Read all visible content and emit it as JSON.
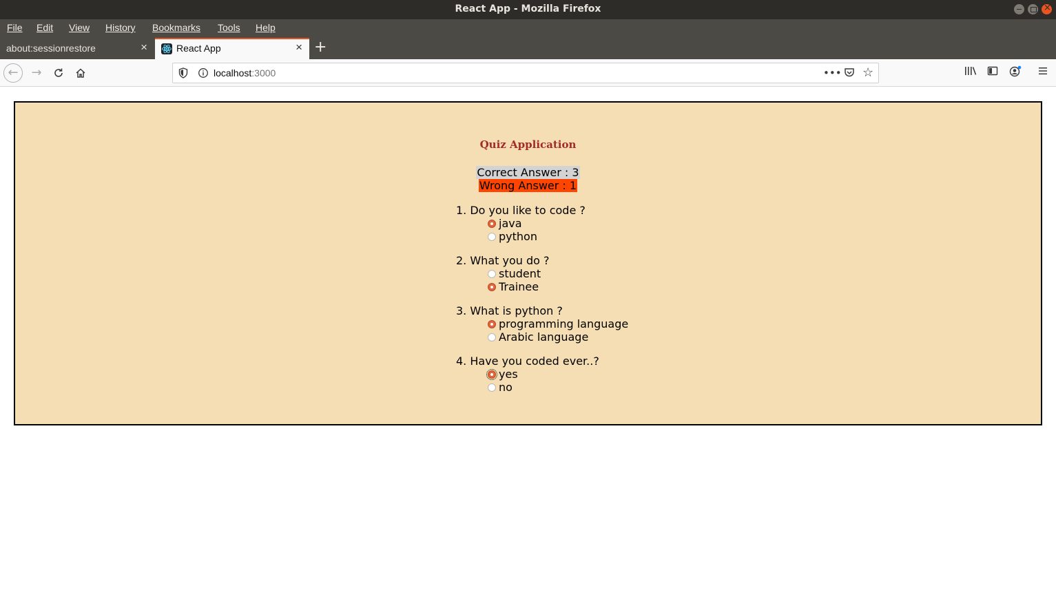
{
  "window": {
    "title": "React App - Mozilla Firefox"
  },
  "menu": {
    "items": [
      {
        "label": "File"
      },
      {
        "label": "Edit"
      },
      {
        "label": "View"
      },
      {
        "label": "History"
      },
      {
        "label": "Bookmarks"
      },
      {
        "label": "Tools"
      },
      {
        "label": "Help"
      }
    ]
  },
  "tabs": [
    {
      "label": "about:sessionrestore",
      "active": false
    },
    {
      "label": "React App",
      "active": true
    }
  ],
  "navbar": {
    "url_host": "localhost",
    "url_port": ":3000"
  },
  "quiz": {
    "title": "Quiz Application",
    "correct_label": "Correct Answer : 3",
    "wrong_label": "Wrong Answer : 1",
    "questions": [
      {
        "text": "1. Do you like to code ?",
        "options": [
          {
            "label": "java",
            "checked": true
          },
          {
            "label": "python",
            "checked": false
          }
        ]
      },
      {
        "text": "2. What you do ?",
        "options": [
          {
            "label": "student",
            "checked": false
          },
          {
            "label": "Trainee",
            "checked": true
          }
        ]
      },
      {
        "text": "3. What is python ?",
        "options": [
          {
            "label": "programming language",
            "checked": true
          },
          {
            "label": "Arabic language",
            "checked": false
          }
        ]
      },
      {
        "text": "4. Have you coded ever..?",
        "options": [
          {
            "label": "yes",
            "checked": true
          },
          {
            "label": "no",
            "checked": false
          }
        ]
      }
    ]
  },
  "colors": {
    "quiz_background": "#f5deb3",
    "title_color": "#a52a2a",
    "correct_highlight": "#d3d3d3",
    "wrong_highlight": "#ff4500",
    "radio_checked": "#e0673c",
    "tab_accent": "#e95420"
  }
}
